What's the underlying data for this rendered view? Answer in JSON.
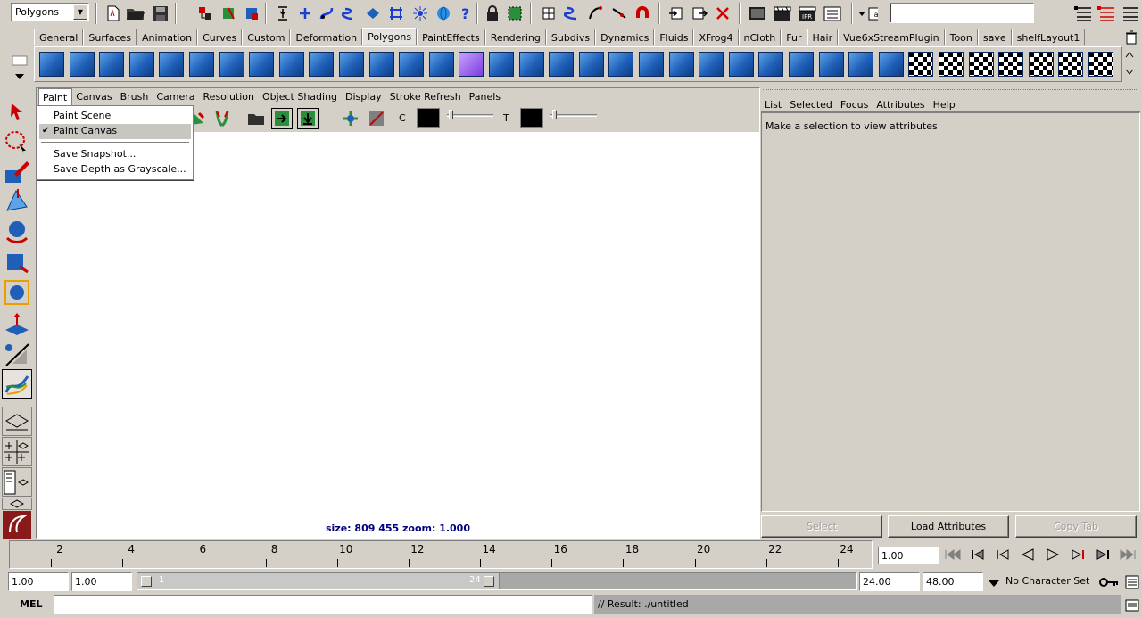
{
  "status_line": {
    "mode": "Polygons",
    "quick_field": ""
  },
  "shelf_tabs": [
    "General",
    "Surfaces",
    "Animation",
    "Curves",
    "Custom",
    "Deformation",
    "Polygons",
    "PaintEffects",
    "Rendering",
    "Subdivs",
    "Dynamics",
    "Fluids",
    "XFrog4",
    "nCloth",
    "Fur",
    "Hair",
    "Vue6xStreamPlugin",
    "Toon",
    "save",
    "shelfLayout1"
  ],
  "active_shelf_tab": "Polygons",
  "paint_panel": {
    "menus": [
      "Paint",
      "Canvas",
      "Brush",
      "Camera",
      "Resolution",
      "Object Shading",
      "Display",
      "Stroke Refresh",
      "Panels"
    ],
    "toolbar": {
      "color_label": "C",
      "transparency_label": "T"
    },
    "canvas_info": "size:  809  455 zoom: 1.000"
  },
  "paint_menu": {
    "items": [
      "Paint Scene",
      "Paint Canvas",
      "Save Snapshot...",
      "Save Depth as Grayscale..."
    ],
    "checked": "Paint Canvas"
  },
  "attribute_editor": {
    "menus": [
      "List",
      "Selected",
      "Focus",
      "Attributes",
      "Help"
    ],
    "message": "Make a selection to view attributes",
    "buttons": {
      "select": "Select",
      "load": "Load Attributes",
      "copy": "Copy Tab"
    }
  },
  "time_slider": {
    "ticks": [
      "2",
      "4",
      "6",
      "8",
      "10",
      "12",
      "14",
      "16",
      "18",
      "20",
      "22",
      "24"
    ],
    "current_frame": "1.00"
  },
  "range_slider": {
    "start_time": "1.00",
    "playback_start": "1.00",
    "range_start_marker": "1",
    "range_end_marker": "24",
    "playback_end": "24.00",
    "end_time": "48.00",
    "character_set": "No Character Set"
  },
  "command_line": {
    "label": "MEL",
    "result": "// Result: ./untitled"
  }
}
